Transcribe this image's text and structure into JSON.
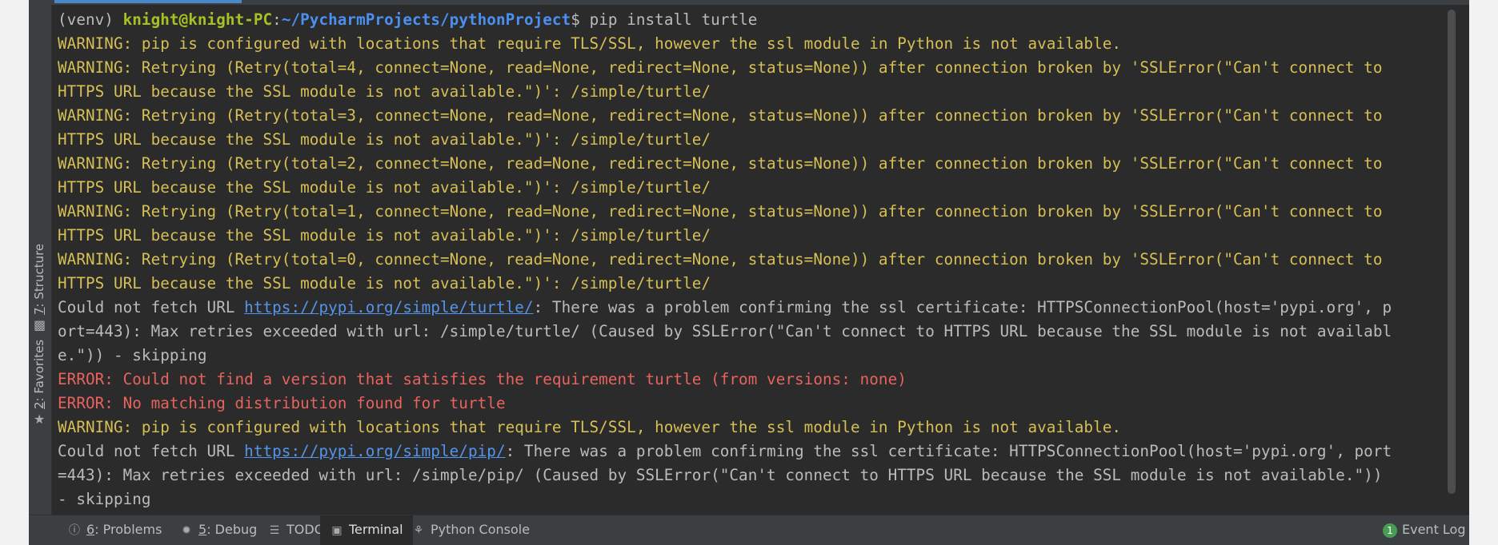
{
  "side_tabs": [
    {
      "num": "7",
      "label": ": Structure",
      "icon": "structure-icon"
    },
    {
      "num": "2",
      "label": ": Favorites",
      "icon": "star-icon"
    }
  ],
  "terminal": {
    "prompt": {
      "venv": "(venv) ",
      "user": "knight@knight-PC",
      "sep": ":",
      "path": "~/PycharmProjects/pythonProject",
      "dollar": "$ ",
      "command": "pip install turtle"
    },
    "lines": [
      {
        "type": "warn",
        "text": "WARNING: pip is configured with locations that require TLS/SSL, however the ssl module in Python is not available."
      },
      {
        "type": "warn",
        "text": "WARNING: Retrying (Retry(total=4, connect=None, read=None, redirect=None, status=None)) after connection broken by 'SSLError(\"Can't connect to"
      },
      {
        "type": "warn",
        "text": "HTTPS URL because the SSL module is not available.\")': /simple/turtle/"
      },
      {
        "type": "warn",
        "text": "WARNING: Retrying (Retry(total=3, connect=None, read=None, redirect=None, status=None)) after connection broken by 'SSLError(\"Can't connect to"
      },
      {
        "type": "warn",
        "text": "HTTPS URL because the SSL module is not available.\")': /simple/turtle/"
      },
      {
        "type": "warn",
        "text": "WARNING: Retrying (Retry(total=2, connect=None, read=None, redirect=None, status=None)) after connection broken by 'SSLError(\"Can't connect to"
      },
      {
        "type": "warn",
        "text": "HTTPS URL because the SSL module is not available.\")': /simple/turtle/"
      },
      {
        "type": "warn",
        "text": "WARNING: Retrying (Retry(total=1, connect=None, read=None, redirect=None, status=None)) after connection broken by 'SSLError(\"Can't connect to"
      },
      {
        "type": "warn",
        "text": "HTTPS URL because the SSL module is not available.\")': /simple/turtle/"
      },
      {
        "type": "warn",
        "text": "WARNING: Retrying (Retry(total=0, connect=None, read=None, redirect=None, status=None)) after connection broken by 'SSLError(\"Can't connect to"
      },
      {
        "type": "warn",
        "text": "HTTPS URL because the SSL module is not available.\")': /simple/turtle/"
      },
      {
        "type": "link",
        "before": "Could not fetch URL ",
        "link": "https://pypi.org/simple/turtle/",
        "after": ": There was a problem confirming the ssl certificate: HTTPSConnectionPool(host='pypi.org', p"
      },
      {
        "type": "plain",
        "text": "ort=443): Max retries exceeded with url: /simple/turtle/ (Caused by SSLError(\"Can't connect to HTTPS URL because the SSL module is not availabl"
      },
      {
        "type": "plain",
        "text": "e.\")) - skipping"
      },
      {
        "type": "err",
        "text": "ERROR: Could not find a version that satisfies the requirement turtle (from versions: none)"
      },
      {
        "type": "err",
        "text": "ERROR: No matching distribution found for turtle"
      },
      {
        "type": "warn",
        "text": "WARNING: pip is configured with locations that require TLS/SSL, however the ssl module in Python is not available."
      },
      {
        "type": "link",
        "before": "Could not fetch URL ",
        "link": "https://pypi.org/simple/pip/",
        "after": ": There was a problem confirming the ssl certificate: HTTPSConnectionPool(host='pypi.org', port"
      },
      {
        "type": "plain",
        "text": "=443): Max retries exceeded with url: /simple/pip/ (Caused by SSLError(\"Can't connect to HTTPS URL because the SSL module is not available.\"))"
      },
      {
        "type": "plain",
        "text": "- skipping"
      }
    ]
  },
  "tool_tabs": [
    {
      "name": "problems",
      "icon": "info-icon",
      "num": "6",
      "label": ": Problems",
      "active": false
    },
    {
      "name": "debug",
      "icon": "bug-icon",
      "num": "5",
      "label": ": Debug",
      "active": false
    },
    {
      "name": "todo",
      "icon": "list-icon",
      "num": "",
      "label": "TODO",
      "active": false
    },
    {
      "name": "terminal",
      "icon": "terminal-icon",
      "num": "",
      "label": "Terminal",
      "active": true
    },
    {
      "name": "python-console",
      "icon": "python-icon",
      "num": "",
      "label": "Python Console",
      "active": false
    }
  ],
  "event_log": {
    "count": "1",
    "label": "Event Log"
  },
  "colors": {
    "warning": "#d6bf55",
    "error": "#e8635d",
    "link": "#5394ec",
    "user": "#a8c023",
    "path": "#4b8ff0"
  }
}
